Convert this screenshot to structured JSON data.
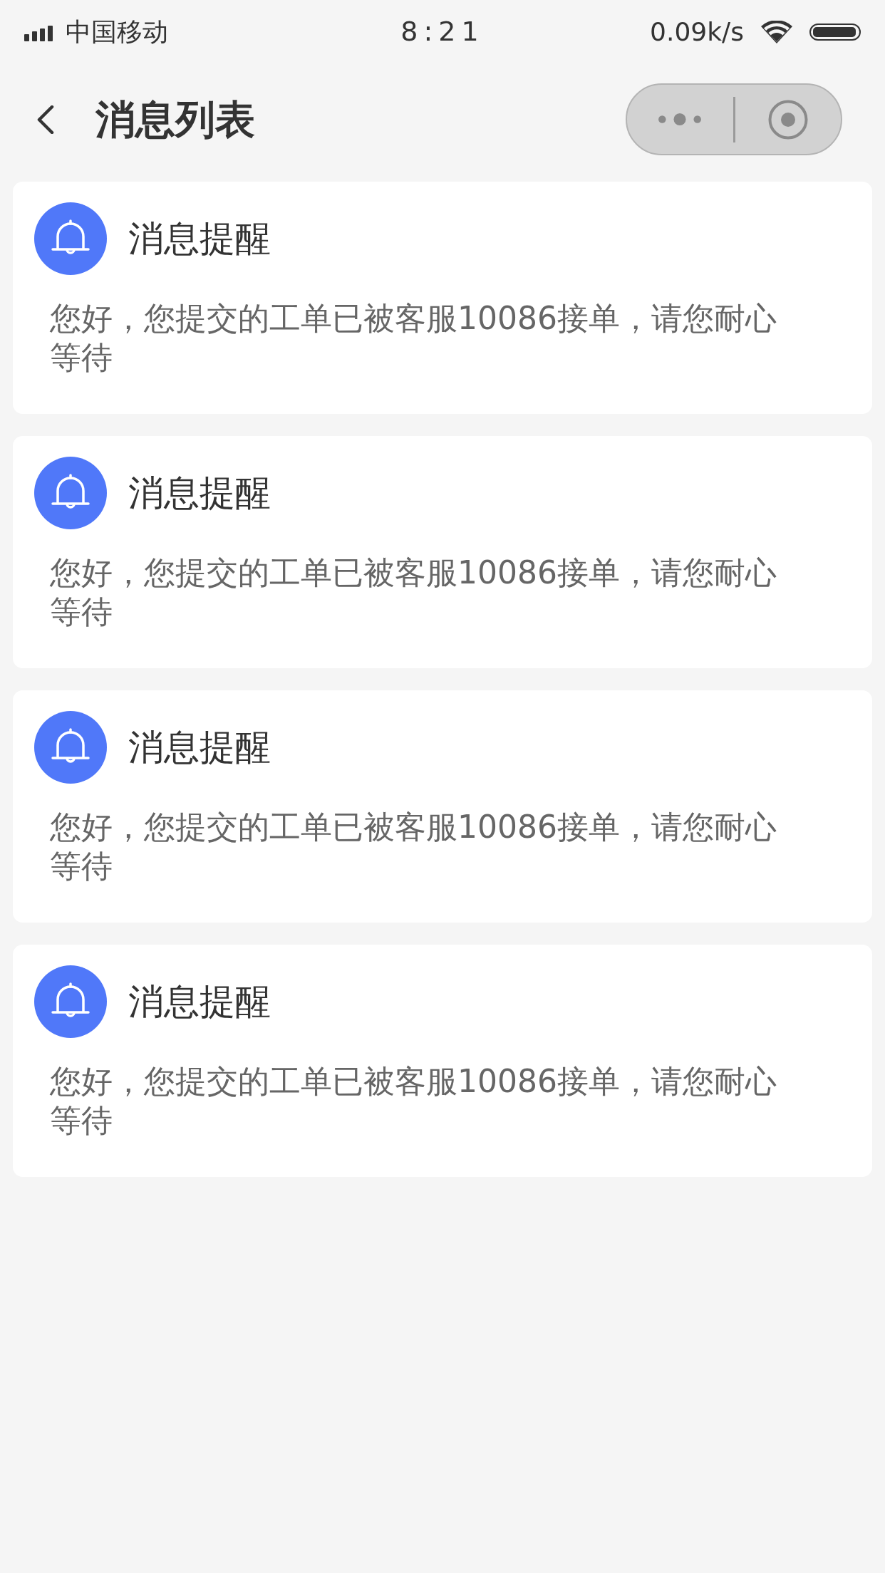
{
  "status_bar": {
    "carrier": "中国移动",
    "time": "8:21",
    "speed": "0.09k/s"
  },
  "header": {
    "title": "消息列表"
  },
  "messages": [
    {
      "title": "消息提醒",
      "body": "您好，您提交的工单已被客服10086接单，请您耐心等待"
    },
    {
      "title": "消息提醒",
      "body": "您好，您提交的工单已被客服10086接单，请您耐心等待"
    },
    {
      "title": "消息提醒",
      "body": "您好，您提交的工单已被客服10086接单，请您耐心等待"
    },
    {
      "title": "消息提醒",
      "body": "您好，您提交的工单已被客服10086接单，请您耐心等待"
    }
  ]
}
